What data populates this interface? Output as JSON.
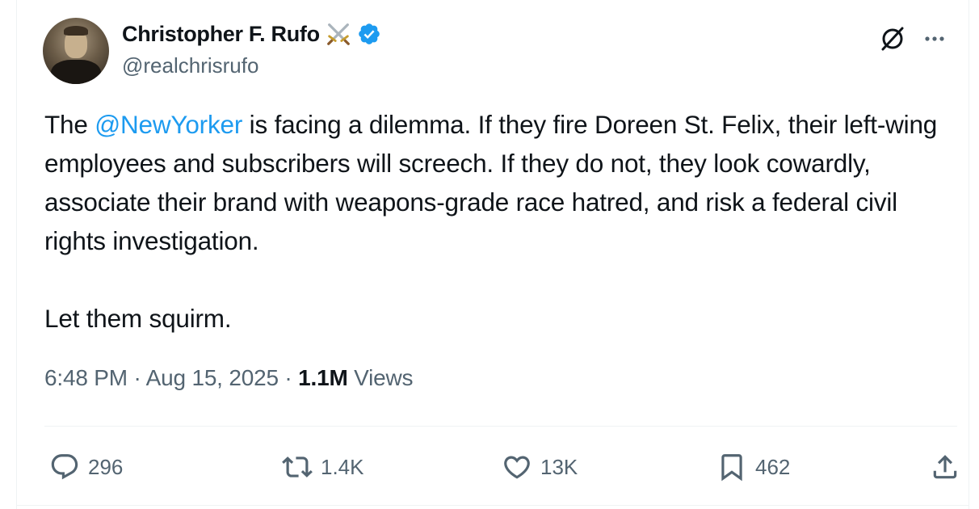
{
  "author": {
    "display_name": "Christopher F. Rufo",
    "emoji": "⚔️",
    "handle": "@realchrisrufo",
    "verified_color": "#1d9bf0"
  },
  "tweet": {
    "segments": {
      "pre": "The ",
      "mention": "@NewYorker",
      "post": " is facing a dilemma. If they fire Doreen St. Felix, their left-wing employees and subscribers will screech. If they do not, they look cowardly, associate their brand with weapons-grade race hatred, and risk a federal civil rights investigation."
    },
    "closing": "Let them squirm.",
    "mention_color": "#1d9bf0"
  },
  "meta": {
    "time": "6:48 PM",
    "sep1": " · ",
    "date": "Aug 15, 2025",
    "sep2": " · ",
    "views_count": "1.1M",
    "views_label": " Views"
  },
  "actions": {
    "replies": "296",
    "reposts": "1.4K",
    "likes": "13K",
    "bookmarks": "462"
  },
  "icons": {
    "grok": "grok-icon",
    "more": "more-icon",
    "reply": "reply-icon",
    "repost": "repost-icon",
    "like": "like-icon",
    "bookmark": "bookmark-icon",
    "share": "share-icon"
  }
}
